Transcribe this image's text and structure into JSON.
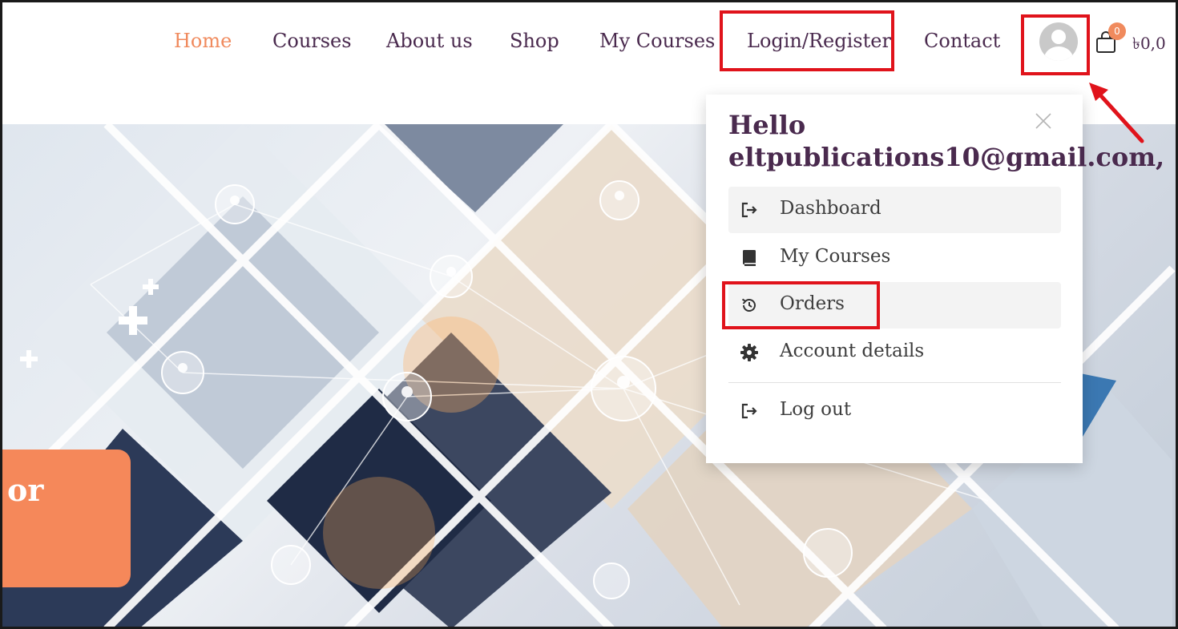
{
  "nav": {
    "items": [
      {
        "label": "Home",
        "active": true
      },
      {
        "label": "Courses"
      },
      {
        "label": "About us"
      },
      {
        "label": "Shop"
      },
      {
        "label": "My Courses"
      },
      {
        "label": "Login/Register"
      },
      {
        "label": "Contact"
      }
    ]
  },
  "cart": {
    "count": "0",
    "total": "৳0,0"
  },
  "account_menu": {
    "greeting_line1": "Hello",
    "greeting_line2": "eltpublications10@gmail.com,",
    "items": [
      {
        "label": "Dashboard",
        "icon": "sign-in-icon"
      },
      {
        "label": "My Courses",
        "icon": "book-icon"
      },
      {
        "label": "Orders",
        "icon": "history-icon"
      },
      {
        "label": "Account details",
        "icon": "gear-icon"
      },
      {
        "label": "Log out",
        "icon": "sign-out-icon"
      }
    ]
  },
  "hero": {
    "card_text": "or"
  },
  "colors": {
    "accent": "#f08a5d",
    "nav_text": "#4a2a4e",
    "highlight": "#e0131b"
  }
}
